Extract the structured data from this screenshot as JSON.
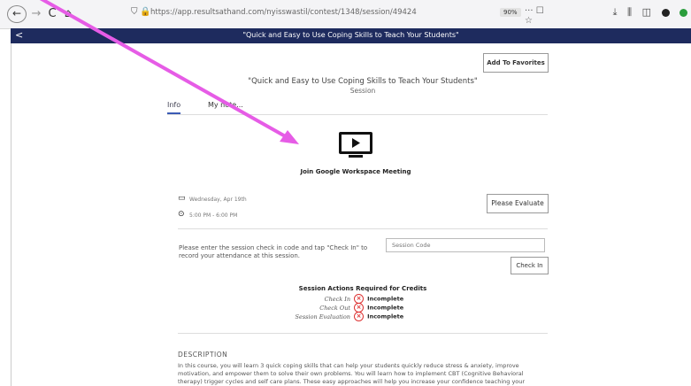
{
  "browser": {
    "back_glyph": "←",
    "forward_glyph": "→",
    "reload_glyph": "C",
    "home_glyph": "⌂",
    "url": "https://app.resultsathand.com/nyisswastil/contest/1348/session/49424",
    "zoom": "90%",
    "more_glyph": "··· ☐ ☆"
  },
  "titlebar": {
    "back_glyph": "<",
    "title": "\"Quick and Easy to Use Coping Skills to Teach Your Students\""
  },
  "favorites_label": "Add To Favorites",
  "session": {
    "title": "\"Quick and Easy to Use Coping Skills to Teach Your Students\"",
    "subtitle": "Session"
  },
  "tabs": [
    {
      "label": "Info"
    },
    {
      "label": "My note..."
    }
  ],
  "meeting": {
    "label": "Join Google Workspace Meeting"
  },
  "details": {
    "date": "Wednesday, Apr 19th",
    "time": "5:00 PM - 6:00 PM",
    "evaluate_label": "Please Evaluate"
  },
  "checkin": {
    "instructions": "Please enter the session check in code and tap \"Check In\" to record your attendance at this session.",
    "placeholder": "Session Code",
    "button_label": "Check In"
  },
  "actions": {
    "title": "Session Actions Required for Credits",
    "items": [
      {
        "label": "Check In",
        "status": "Incomplete"
      },
      {
        "label": "Check Out",
        "status": "Incomplete"
      },
      {
        "label": "Session Evaluation",
        "status": "Incomplete"
      }
    ]
  },
  "description": {
    "title": "DESCRIPTION",
    "text": "In this course, you will learn 3 quick coping skills that can help your students quickly reduce stress & anxiety, improve motivation, and empower them to solve their own problems. You will learn how to implement CBT (Cognitive Behavioral therapy) trigger cycles and self care plans. These easy approaches will help you increase your confidence teaching your"
  },
  "colors": {
    "titlebar": "#1e2b5e",
    "annotation_arrow": "#e65ce6",
    "incomplete": "#d33333"
  }
}
